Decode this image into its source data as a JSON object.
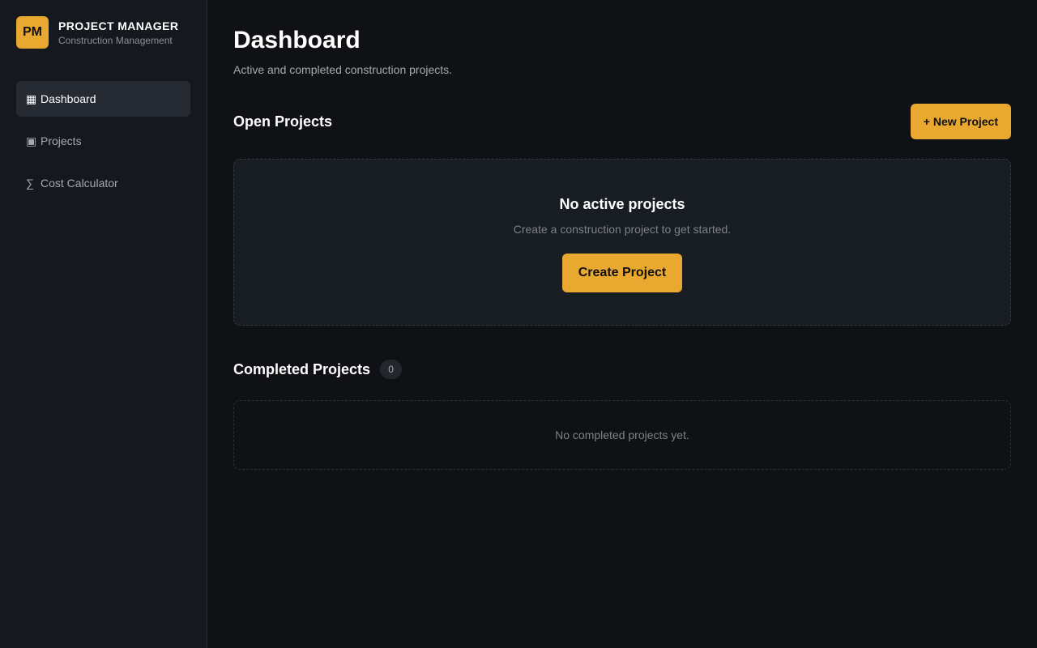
{
  "brand": {
    "logo_text": "PM",
    "name": "PROJECT MANAGER",
    "subtitle": "Construction Management"
  },
  "sidebar": {
    "items": [
      {
        "icon": "▦",
        "icon_name": "grid-icon",
        "label": "Dashboard",
        "active": true
      },
      {
        "icon": "▣",
        "icon_name": "square-icon",
        "label": "Projects",
        "active": false
      },
      {
        "icon": "∑",
        "icon_name": "sigma-icon",
        "label": "Cost Calculator",
        "active": false
      }
    ]
  },
  "main": {
    "title": "Dashboard",
    "subtitle": "Active and completed construction projects.",
    "open_projects": {
      "title": "Open Projects",
      "new_button": "+ New Project",
      "empty_title": "No active projects",
      "empty_text": "Create a construction project to get started.",
      "create_button": "Create Project"
    },
    "completed_projects": {
      "title": "Completed Projects",
      "count": "0",
      "empty_text": "No completed projects yet."
    }
  },
  "colors": {
    "accent": "#e9a82f",
    "background": "#101114",
    "sidebar": "#15181e"
  }
}
